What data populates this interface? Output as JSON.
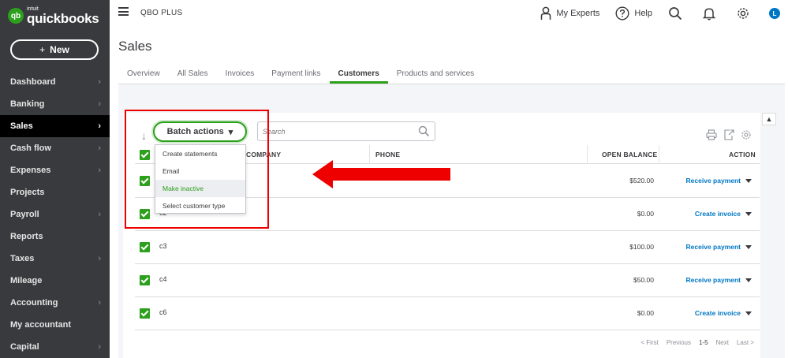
{
  "brand": {
    "mark": "qb",
    "intuit": "intuit",
    "name": "quickbooks",
    "accent": "#2CA01C"
  },
  "new_button": {
    "plus": "+",
    "label": "New"
  },
  "sidebar": {
    "items": [
      {
        "label": "Dashboard",
        "chevron": "›"
      },
      {
        "label": "Banking",
        "chevron": "›"
      },
      {
        "label": "Sales",
        "chevron": "›",
        "active": true
      },
      {
        "label": "Cash flow",
        "chevron": "›"
      },
      {
        "label": "Expenses",
        "chevron": "›"
      },
      {
        "label": "Projects",
        "chevron": ""
      },
      {
        "label": "Payroll",
        "chevron": "›"
      },
      {
        "label": "Reports",
        "chevron": ""
      },
      {
        "label": "Taxes",
        "chevron": "›"
      },
      {
        "label": "Mileage",
        "chevron": ""
      },
      {
        "label": "Accounting",
        "chevron": "›"
      },
      {
        "label": "My accountant",
        "chevron": ""
      },
      {
        "label": "Capital",
        "chevron": "›"
      }
    ]
  },
  "header": {
    "company": "QBO PLUS",
    "my_experts": "My Experts",
    "help": "Help",
    "avatar": "L"
  },
  "page": {
    "title": "Sales",
    "tabs": [
      {
        "label": "Overview"
      },
      {
        "label": "All Sales"
      },
      {
        "label": "Invoices"
      },
      {
        "label": "Payment links"
      },
      {
        "label": "Customers",
        "active": true
      },
      {
        "label": "Products and services"
      }
    ]
  },
  "toolbar": {
    "batch_label": "Batch actions",
    "batch_caret": "▾",
    "search_placeholder": "Search",
    "scroll_up": "▲"
  },
  "batch_menu": {
    "items": [
      {
        "label": "Create statements"
      },
      {
        "label": "Email"
      },
      {
        "label": "Make inactive",
        "highlighted": true
      },
      {
        "label": "Select customer type"
      }
    ]
  },
  "table": {
    "headers": {
      "company": "COMPANY",
      "phone": "PHONE",
      "open_balance": "OPEN BALANCE",
      "action": "ACTION"
    },
    "rows": [
      {
        "name": "",
        "balance": "$520.00",
        "action": "Receive payment"
      },
      {
        "name": "c2",
        "balance": "$0.00",
        "action": "Create invoice"
      },
      {
        "name": "c3",
        "balance": "$100.00",
        "action": "Receive payment"
      },
      {
        "name": "c4",
        "balance": "$50.00",
        "action": "Receive payment"
      },
      {
        "name": "c6",
        "balance": "$0.00",
        "action": "Create invoice"
      }
    ]
  },
  "pager": {
    "first": "< First",
    "previous": "Previous",
    "range": "1-5",
    "next": "Next",
    "last": "Last >"
  }
}
